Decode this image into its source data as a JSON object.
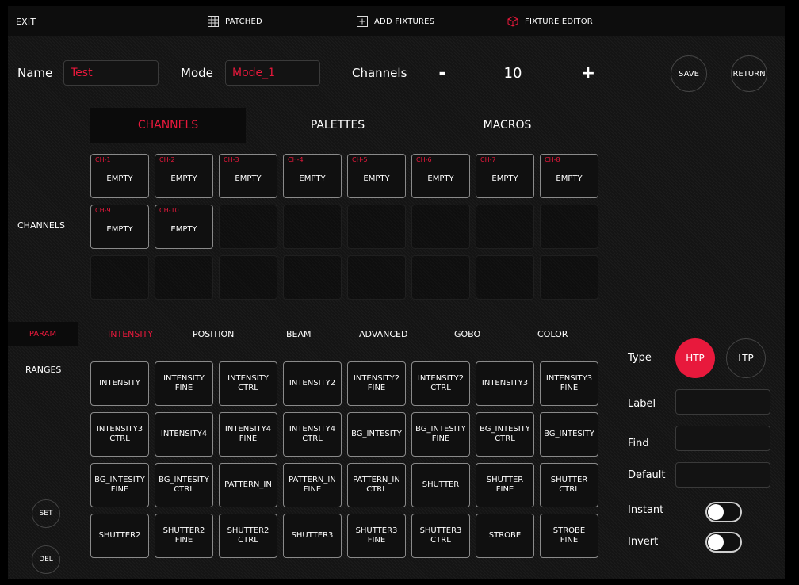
{
  "topbar": {
    "exit": "EXIT",
    "patched": "PATCHED",
    "add_fixtures": "ADD FIXTURES",
    "fixture_editor": "FIXTURE EDITOR"
  },
  "header": {
    "name_label": "Name",
    "name_value": "Test",
    "mode_label": "Mode",
    "mode_value": "Mode_1",
    "channels_label": "Channels",
    "minus": "-",
    "channels_value": "10",
    "plus": "+",
    "save": "SAVE",
    "return": "RETURN"
  },
  "tabs": [
    "CHANNELS",
    "PALETTES",
    "MACROS"
  ],
  "channels": {
    "side_label": "CHANNELS",
    "items": [
      {
        "ch": "CH-1",
        "value": "EMPTY"
      },
      {
        "ch": "CH-2",
        "value": "EMPTY"
      },
      {
        "ch": "CH-3",
        "value": "EMPTY"
      },
      {
        "ch": "CH-4",
        "value": "EMPTY"
      },
      {
        "ch": "CH-5",
        "value": "EMPTY"
      },
      {
        "ch": "CH-6",
        "value": "EMPTY"
      },
      {
        "ch": "CH-7",
        "value": "EMPTY"
      },
      {
        "ch": "CH-8",
        "value": "EMPTY"
      },
      {
        "ch": "CH-9",
        "value": "EMPTY"
      },
      {
        "ch": "CH-10",
        "value": "EMPTY"
      }
    ]
  },
  "params": {
    "param_tab": "PARAM",
    "ranges_label": "RANGES",
    "categories": [
      "INTENSITY",
      "POSITION",
      "BEAM",
      "ADVANCED",
      "GOBO",
      "COLOR"
    ],
    "buttons": [
      [
        "INTENSITY"
      ],
      [
        "INTENSITY",
        "FINE"
      ],
      [
        "INTENSITY",
        "CTRL"
      ],
      [
        "INTENSITY2"
      ],
      [
        "INTENSITY2",
        "FINE"
      ],
      [
        "INTENSITY2",
        "CTRL"
      ],
      [
        "INTENSITY3"
      ],
      [
        "INTENSITY3",
        "FINE"
      ],
      [
        "INTENSITY3",
        "CTRL"
      ],
      [
        "INTENSITY4"
      ],
      [
        "INTENSITY4",
        "FINE"
      ],
      [
        "INTENSITY4",
        "CTRL"
      ],
      [
        "BG_INTESITY"
      ],
      [
        "BG_INTESITY",
        "FINE"
      ],
      [
        "BG_INTESITY",
        "CTRL"
      ],
      [
        "BG_INTESITY"
      ],
      [
        "BG_INTESITY",
        "FINE"
      ],
      [
        "BG_INTESITY",
        "CTRL"
      ],
      [
        "PATTERN_IN"
      ],
      [
        "PATTERN_IN",
        "FINE"
      ],
      [
        "PATTERN_IN",
        "CTRL"
      ],
      [
        "SHUTTER"
      ],
      [
        "SHUTTER",
        "FINE"
      ],
      [
        "SHUTTER",
        "CTRL"
      ],
      [
        "SHUTTER2"
      ],
      [
        "SHUTTER2",
        "FINE"
      ],
      [
        "SHUTTER2",
        "CTRL"
      ],
      [
        "SHUTTER3"
      ],
      [
        "SHUTTER3",
        "FINE"
      ],
      [
        "SHUTTER3",
        "CTRL"
      ],
      [
        "STROBE"
      ],
      [
        "STROBE",
        "FINE"
      ]
    ],
    "set": "SET",
    "del": "DEL"
  },
  "right_panel": {
    "type_label": "Type",
    "htp": "HTP",
    "ltp": "LTP",
    "label_label": "Label",
    "find_label": "Find",
    "default_label": "Default",
    "instant_label": "Instant",
    "invert_label": "Invert"
  },
  "colors": {
    "accent": "#e8193c",
    "background": "#141414",
    "border": "#8a8a8a"
  }
}
